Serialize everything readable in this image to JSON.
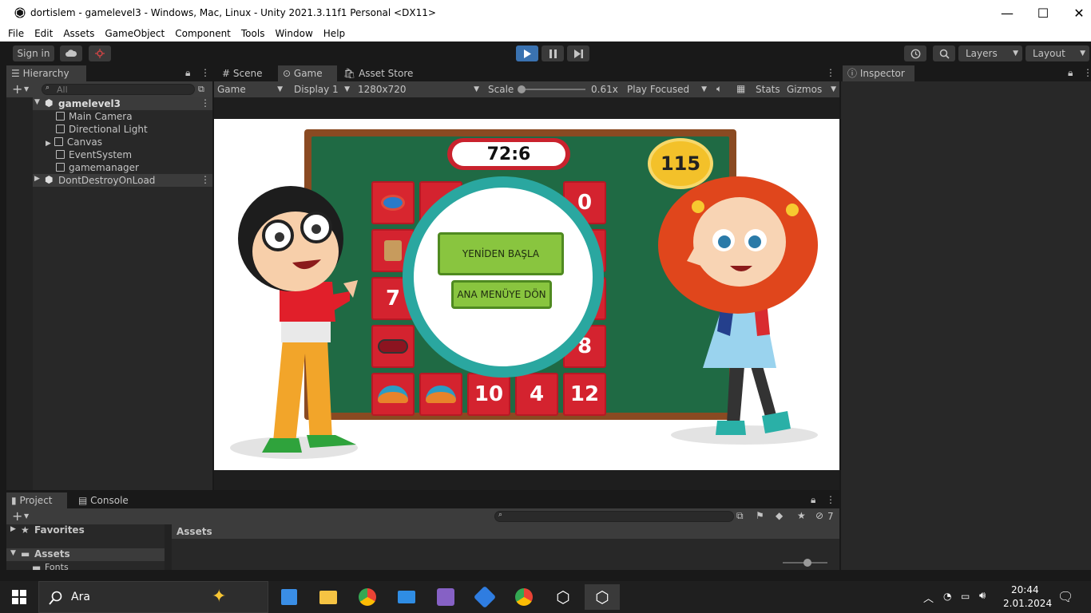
{
  "window": {
    "title": "dortislem - gamelevel3 - Windows, Mac, Linux - Unity 2021.3.11f1 Personal <DX11>",
    "minimize": "—",
    "maximize": "☐",
    "close": "✕"
  },
  "menu": [
    "File",
    "Edit",
    "Assets",
    "GameObject",
    "Component",
    "Tools",
    "Window",
    "Help"
  ],
  "toolbar": {
    "sign_in": "Sign in",
    "layers": "Layers",
    "layout": "Layout"
  },
  "hierarchy": {
    "tab": "Hierarchy",
    "search_placeholder": "All",
    "scene": "gamelevel3",
    "children": [
      "Main Camera",
      "Directional Light",
      "Canvas",
      "EventSystem",
      "gamemanager"
    ],
    "dontdestroy": "DontDestroyOnLoad"
  },
  "center_tabs": {
    "scene": "Scene",
    "game": "Game",
    "asset_store": "Asset Store"
  },
  "game_toolbar": {
    "game": "Game",
    "display": "Display 1",
    "resolution": "1280x720",
    "scale_label": "Scale",
    "scale_value": "0.61x",
    "play_focused": "Play Focused",
    "stats": "Stats",
    "gizmos": "Gizmos",
    "scale_fraction": 0.0
  },
  "game": {
    "timer": "72:6",
    "score": "115",
    "restart_button": "YENİDEN BAŞLA",
    "menu_button": "ANA MENÜYE DÖN",
    "tiles": [
      "0",
      "7",
      "8",
      "10",
      "4",
      "12"
    ]
  },
  "inspector": {
    "tab": "Inspector"
  },
  "bottom": {
    "project_tab": "Project",
    "console_tab": "Console",
    "favorites": "Favorites",
    "assets": "Assets",
    "fonts": "Fonts",
    "assets_header": "Assets",
    "hidden_count": "7"
  },
  "taskbar": {
    "search": "Ara",
    "time": "20:44",
    "date": "2.01.2024"
  },
  "colors": {
    "editor_bg": "#282828",
    "play_active": "#3a72b0",
    "tile_red": "#d4232f",
    "board_green": "#1f6a44",
    "button_green": "#89c53f",
    "ring_teal": "#2aa7a0"
  }
}
